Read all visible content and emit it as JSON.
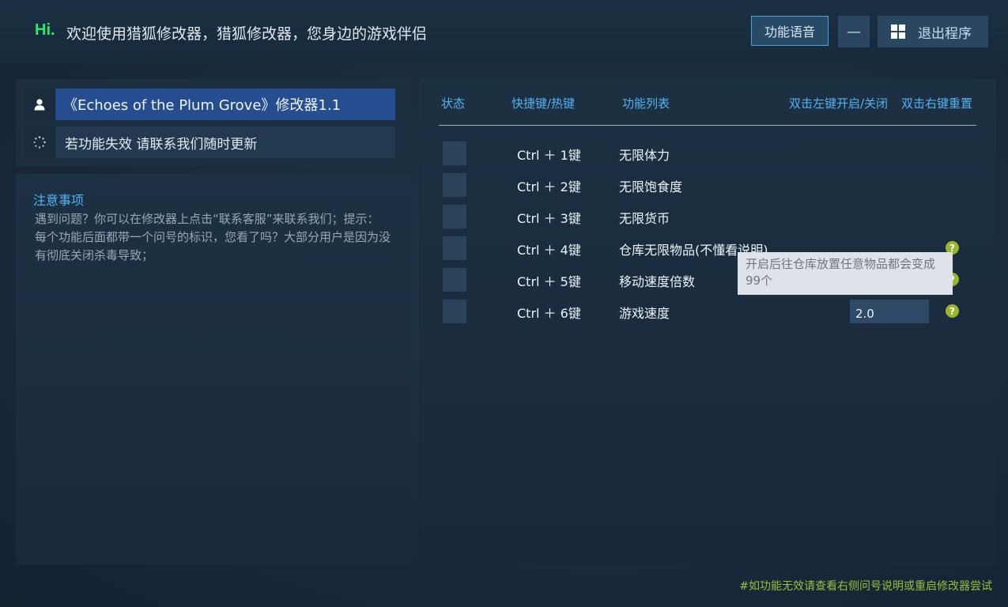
{
  "header": {
    "hi": "Hi.",
    "welcome": "欢迎使用猎狐修改器，猎狐修改器，您身边的游戏伴侣",
    "voice_button": "功能语音",
    "minimize_button": "—",
    "exit_button": "退出程序"
  },
  "left_panel": {
    "game_title": "《Echoes of the Plum Grove》修改器1.1",
    "update_notice": "若功能失效  请联系我们随时更新",
    "notes_title": "注意事项",
    "notes_text": "遇到问题？你可以在修改器上点击“联系客服”来联系我们；提示：每个功能后面都带一个问号的标识，您看了吗？大部分用户是因为没有彻底关闭杀毒导致；"
  },
  "table": {
    "headers": {
      "status": "状态",
      "hotkey": "快捷键/热键",
      "features": "功能列表",
      "left_click": "双击左键开启/关闭",
      "right_click": "双击右键重置"
    },
    "rows": [
      {
        "hotkey": "Ctrl ＋ 1键",
        "feature": "无限体力"
      },
      {
        "hotkey": "Ctrl ＋ 2键",
        "feature": "无限饱食度"
      },
      {
        "hotkey": "Ctrl ＋ 3键",
        "feature": "无限货币"
      },
      {
        "hotkey": "Ctrl ＋ 4键",
        "feature": "仓库无限物品(不懂看说明)",
        "help": "?"
      },
      {
        "hotkey": "Ctrl ＋ 5键",
        "feature": "移动速度倍数",
        "help": "?"
      },
      {
        "hotkey": "Ctrl ＋ 6键",
        "feature": "游戏速度",
        "value": "2.0",
        "help": "?"
      }
    ]
  },
  "tooltip": {
    "text": "开启后往仓库放置任意物品都会变成99个"
  },
  "footer": {
    "text": "#如功能无效请查看右侧问号说明或重启修改器尝试"
  },
  "colors": {
    "accent_blue": "#55b2f0",
    "hi_green": "#2ee86a",
    "help_green": "#98b62e",
    "selected_row": "#254d8f"
  }
}
